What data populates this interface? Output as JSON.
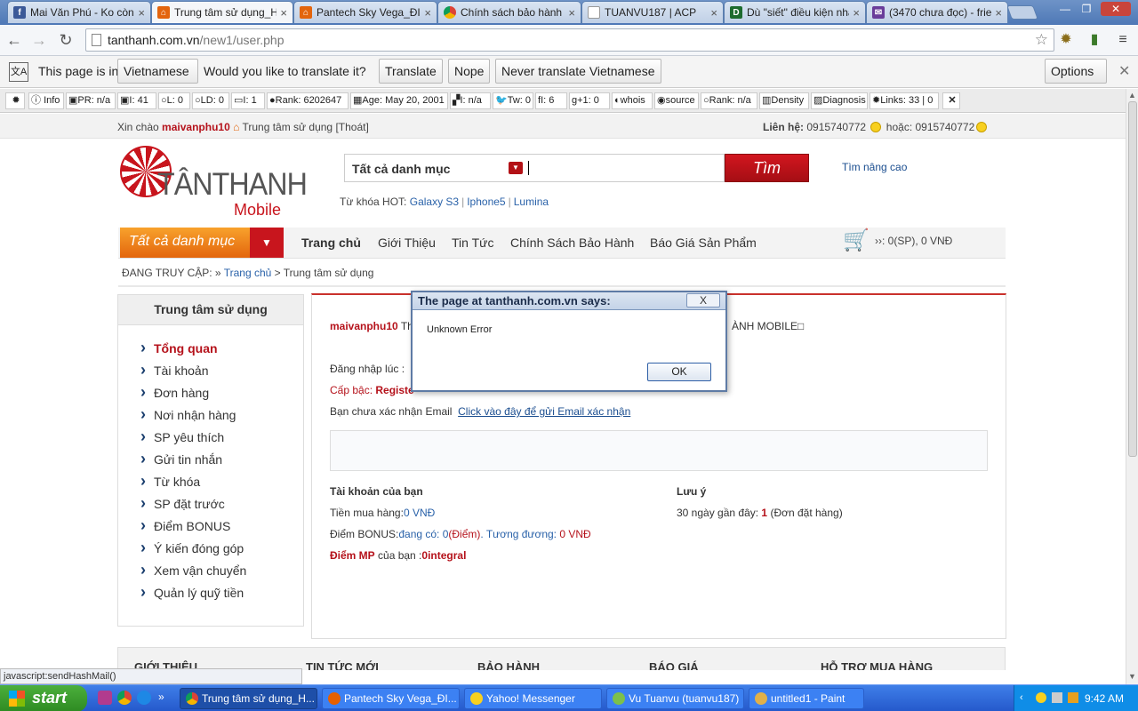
{
  "browser": {
    "tabs": [
      {
        "title": "Mai Văn Phú - Ko còn t",
        "icon": "facebook-icon",
        "color": "#3b5998"
      },
      {
        "title": "Trung tâm sử dụng_H",
        "icon": "shop-icon",
        "color": "#e3650d"
      },
      {
        "title": "Pantech Sky Vega_ĐI",
        "icon": "shop-icon",
        "color": "#e3650d"
      },
      {
        "title": "Chính sách bảo hành",
        "icon": "chrome-icon",
        "color": "#4285f4"
      },
      {
        "title": "TUANVU187 | ACP",
        "icon": "page-icon",
        "color": "#999999"
      },
      {
        "title": "Dù \"siết\" điều kiện nhậ",
        "icon": "d-icon",
        "color": "#1d6b2e"
      },
      {
        "title": "(3470 chưa đọc) - frien",
        "icon": "mail-icon",
        "color": "#6a3d9a"
      }
    ],
    "url_host": "tanthanh.com.vn",
    "url_path": "/new1/user.php"
  },
  "translate": {
    "prefix": "This page is in",
    "language": "Vietnamese",
    "question": "Would you like to translate it?",
    "translate_btn": "Translate",
    "nope_btn": "Nope",
    "never_btn": "Never translate Vietnamese",
    "options_btn": "Options"
  },
  "seo": {
    "items": [
      "Info",
      "PR: n/a",
      "I: 41",
      "L: 0",
      "LD: 0",
      "I: 1",
      "Rank: 6202647",
      "Age: May 20, 2001",
      "I: n/a",
      "Tw: 0",
      "I: 6",
      "+1: 0",
      "whois",
      "source",
      "Rank: n/a",
      "Density",
      "Diagnosis",
      "Links: 33 | 0"
    ]
  },
  "site": {
    "greet_prefix": "Xin chào",
    "username": "maivanphu10",
    "center_link": "Trung tâm sử dụng",
    "logout": "[Thoát]",
    "contact_label": "Liên hệ:",
    "phone1": "0915740772",
    "or": "hoặc:",
    "phone2": "0915740772",
    "logo_name": "TÂNTHANH",
    "logo_sub": "Mobile",
    "search_category": "Tất cả danh mục",
    "search_btn": "Tìm",
    "advanced": "Tìm nâng cao",
    "hot_label": "Từ khóa HOT:",
    "hot": [
      "Galaxy S3",
      "Iphone5",
      "Lumina"
    ],
    "all_categories": "Tất cả danh mục",
    "nav": [
      "Trang chủ",
      "Giới Thiệu",
      "Tin Tức",
      "Chính Sách Bảo Hành",
      "Báo Giá Sản Phẩm"
    ],
    "cart": "››: 0(SP), 0 VNĐ",
    "crumb_label": "ĐANG TRUY CẬP: »",
    "crumb_home": "Trang chủ",
    "crumb_current": "> Trung tâm sử dụng",
    "sidebar_title": "Trung tâm sử dụng",
    "sidebar": [
      "Tổng quan",
      "Tài khoản",
      "Đơn hàng",
      "Nơi nhận hàng",
      "SP yêu thích",
      "Gửi tin nhắn",
      "Từ khóa",
      "SP đặt trước",
      "Điểm BONUS",
      "Ý kiến đóng góp",
      "Xem vận chuyển",
      "Quản lý quỹ tiền"
    ],
    "main": {
      "user": "maivanphu10",
      "user_suffix": "Th",
      "brand_tail": "ÀNH MOBILE",
      "login_label": "Đăng nhập lúc : ",
      "rank_label": "Cấp bậc: ",
      "rank_value": "Registe",
      "email_text": "Bạn chưa xác nhận Email",
      "email_link": "Click vào đây để gửi Email xác nhận",
      "account_title": "Tài khoản của bạn",
      "spent_label": "Tiền mua hàng:",
      "spent_value": "0 VNĐ",
      "bonus_label": "Điểm BONUS:",
      "bonus_has": "đang có: 0",
      "bonus_unit": "(Điểm)",
      "bonus_eq": ". Tương đương: ",
      "bonus_vnd": "0 VNĐ",
      "mp_label": "Điểm MP",
      "mp_mid": " của bạn :",
      "mp_value": "0integral",
      "note_title": "Lưu ý",
      "note_text": "30 ngày gần đây: ",
      "note_count": "1",
      "note_tail": " (Đơn đặt hàng)"
    },
    "footer": [
      "GIỚI THIỆU",
      "TIN TỨC MỚI",
      "BẢO HÀNH",
      "BÁO GIÁ",
      "HỖ TRỢ MUA HÀNG"
    ]
  },
  "dialog": {
    "title": "The page at tanthanh.com.vn says:",
    "close": "X",
    "message": "Unknown Error",
    "ok": "OK"
  },
  "status_bar": "javascript:sendHashMail()",
  "taskbar": {
    "start": "start",
    "tasks": [
      "Trung tâm sử dụng_H...",
      "Pantech Sky Vega_ĐI...",
      "Yahoo! Messenger",
      "Vu Tuanvu (tuanvu187)",
      "untitled1 - Paint"
    ],
    "time": "9:42 AM"
  }
}
